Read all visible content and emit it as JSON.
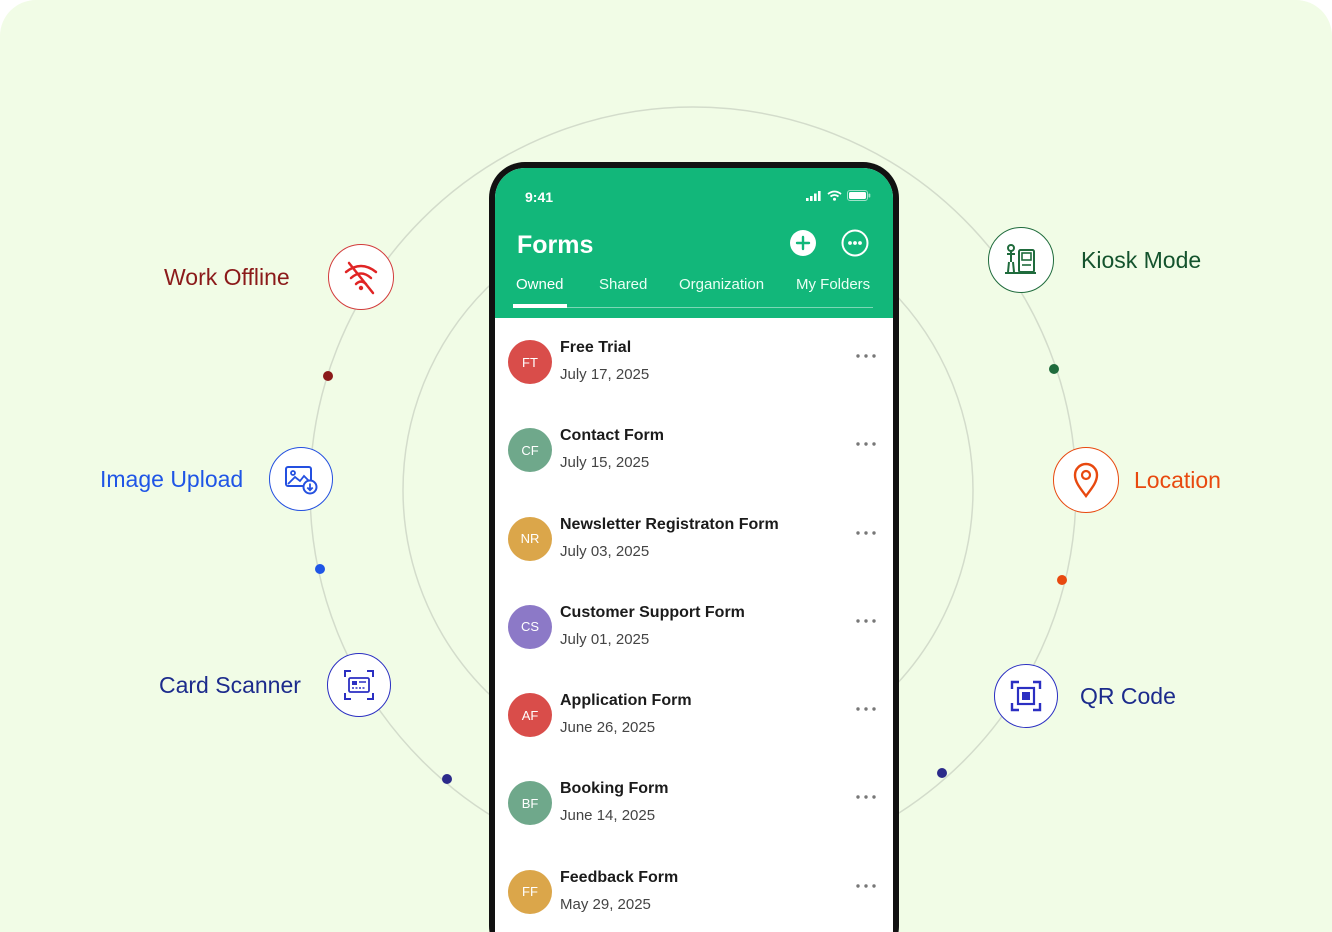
{
  "colors": {
    "background": "#f1fce6",
    "brand_green": "#12b77a",
    "orbit_line": "#d3dccb"
  },
  "features": {
    "work_offline": {
      "label": "Work Offline",
      "icon": "wifi-off-icon",
      "color": "#8b1a1a",
      "ring": "#d23b3b"
    },
    "image_upload": {
      "label": "Image Upload",
      "icon": "image-upload-icon",
      "color": "#1f55e6",
      "ring": "#2450e0"
    },
    "card_scanner": {
      "label": "Card Scanner",
      "icon": "card-scan-icon",
      "color": "#1c2b8c",
      "ring": "#2b2fc2"
    },
    "kiosk_mode": {
      "label": "Kiosk Mode",
      "icon": "kiosk-icon",
      "color": "#14532d",
      "ring": "#1f6b3c"
    },
    "location": {
      "label": "Location",
      "icon": "location-pin-icon",
      "color": "#e8490f",
      "ring": "#e8490f"
    },
    "qr_code": {
      "label": "QR Code",
      "icon": "qr-code-icon",
      "color": "#1c2b8c",
      "ring": "#2b2fc2"
    }
  },
  "phone": {
    "status_time": "9:41",
    "app_title": "Forms",
    "tabs": [
      "Owned",
      "Shared",
      "Organization",
      "My Folders"
    ],
    "active_tab": "Owned",
    "forms": [
      {
        "initials": "FT",
        "title": "Free Trial",
        "date": "July 17, 2025",
        "avatar_color": "#d94d4a"
      },
      {
        "initials": "CF",
        "title": "Contact Form",
        "date": "July 15, 2025",
        "avatar_color": "#6fa88b"
      },
      {
        "initials": "NR",
        "title": "Newsletter Registraton Form",
        "date": "July 03, 2025",
        "avatar_color": "#dba64a"
      },
      {
        "initials": "CS",
        "title": "Customer Support Form",
        "date": "July 01, 2025",
        "avatar_color": "#8c79c7"
      },
      {
        "initials": "AF",
        "title": "Application Form",
        "date": "June 26, 2025",
        "avatar_color": "#d94d4a"
      },
      {
        "initials": "BF",
        "title": "Booking Form",
        "date": "June 14, 2025",
        "avatar_color": "#6fa88b"
      },
      {
        "initials": "FF",
        "title": "Feedback Form",
        "date": "May 29, 2025",
        "avatar_color": "#dba64a"
      }
    ]
  }
}
